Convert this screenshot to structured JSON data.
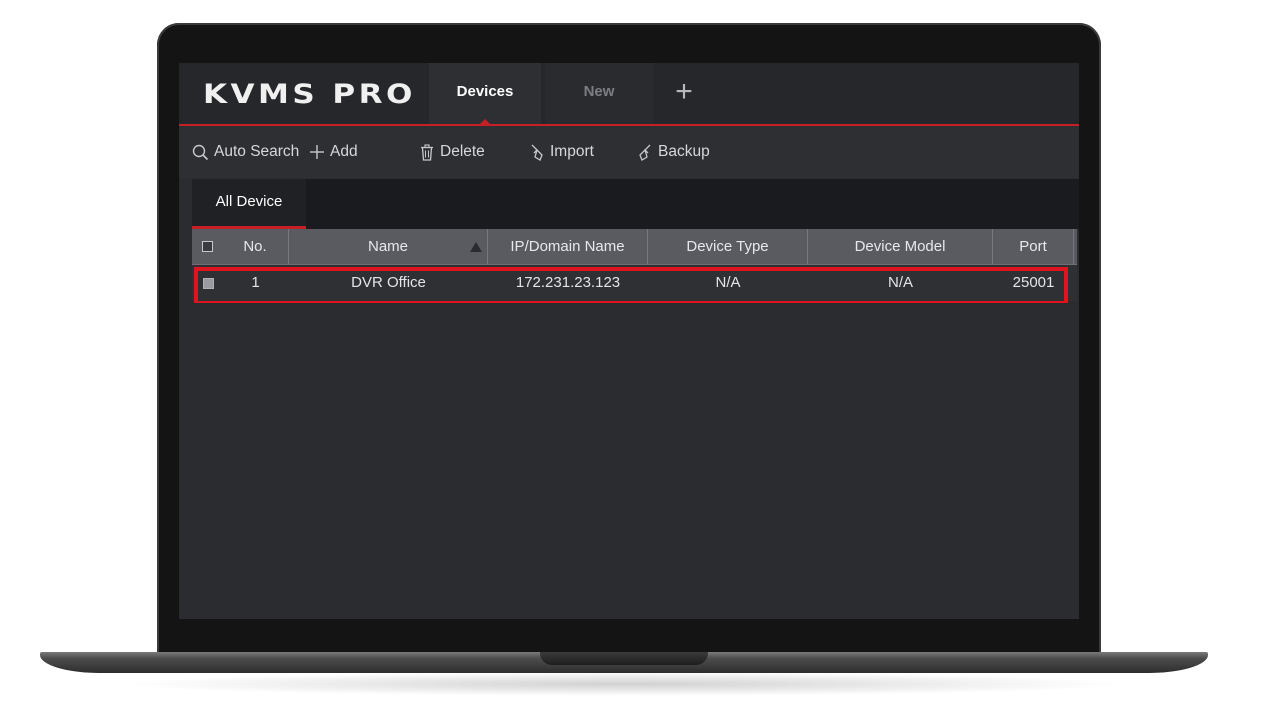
{
  "app": {
    "logo": "KVMS PRO"
  },
  "tabs": [
    {
      "label": "Devices",
      "active": true
    },
    {
      "label": "New",
      "active": false
    }
  ],
  "add_tab_label": "+",
  "toolbar": {
    "auto_search": "Auto Search",
    "add": "Add",
    "delete": "Delete",
    "import": "Import",
    "backup": "Backup"
  },
  "device_tab": {
    "label": "All Device"
  },
  "table": {
    "columns": [
      "No.",
      "Name",
      "IP/Domain Name",
      "Device Type",
      "Device Model",
      "Port"
    ],
    "rows": [
      {
        "no": "1",
        "name": "DVR Office",
        "ip": "172.231.23.123",
        "type": "N/A",
        "model": "N/A",
        "port": "25001"
      }
    ]
  },
  "colors": {
    "accent": "#c62026",
    "highlight": "#e0141e",
    "background": "#2b2c30",
    "header": "#5a5b60"
  }
}
